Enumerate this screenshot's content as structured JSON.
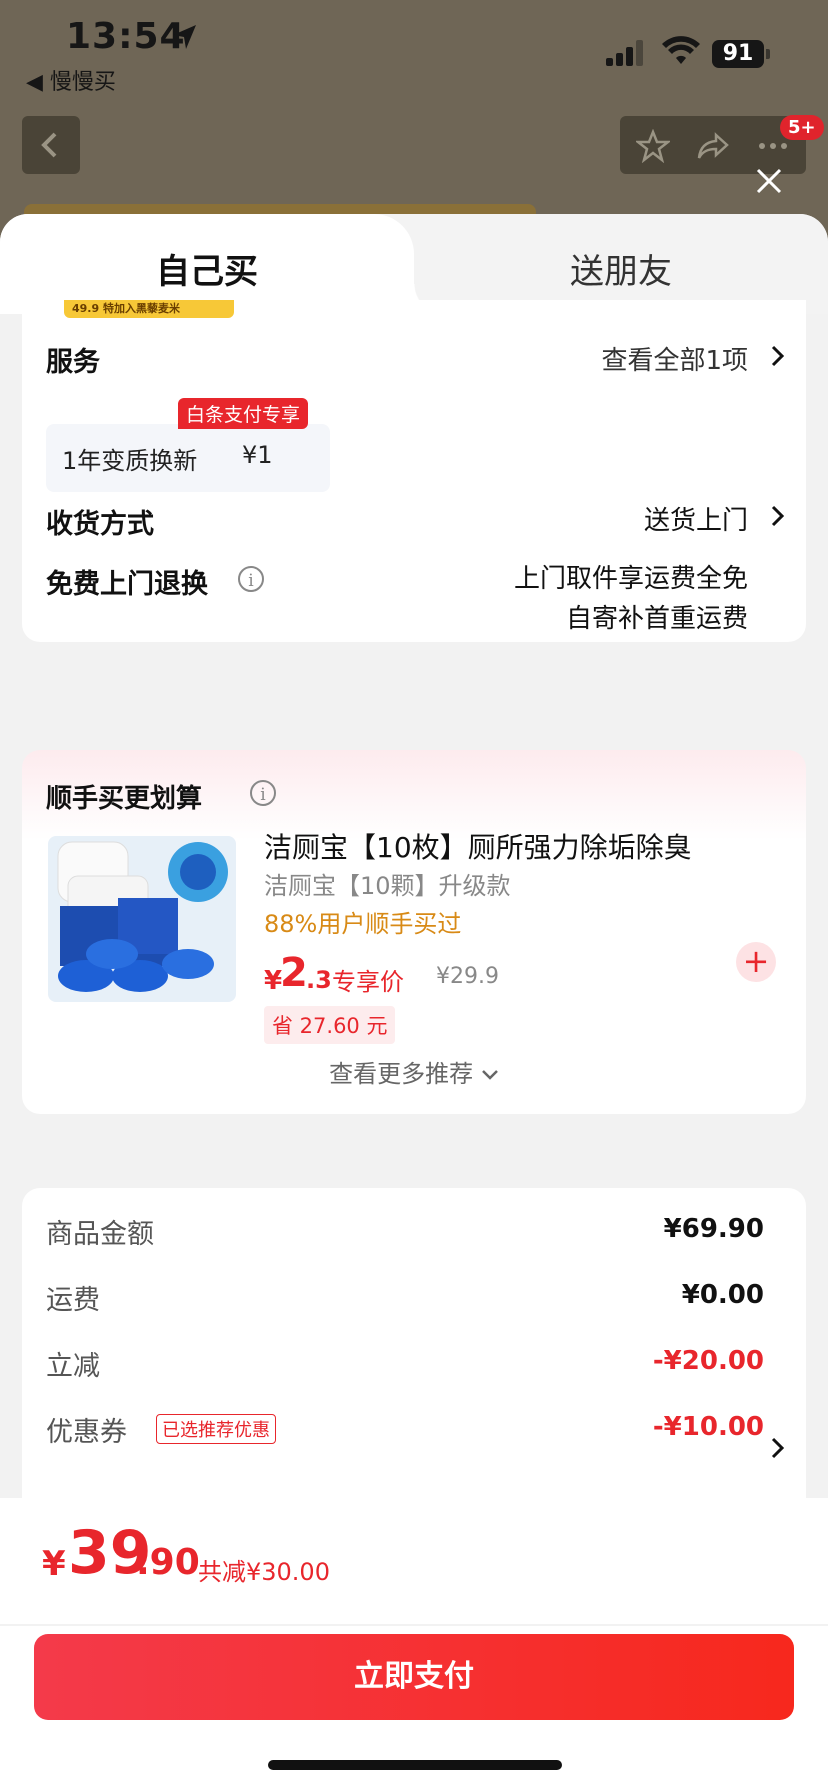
{
  "status_bar": {
    "time": "13:54",
    "back_app": "◀ 慢慢买",
    "battery": "91"
  },
  "nav": {
    "badge": "5+"
  },
  "tabs": [
    {
      "label": "自己买",
      "active": true
    },
    {
      "label": "送朋友",
      "active": false
    }
  ],
  "promo_strip_text": "特加入黑藜麦米",
  "promo_strip_price": "49.9",
  "service": {
    "title": "服务",
    "view_all": "查看全部1项",
    "item_name": "1年变质换新",
    "item_price": "¥1",
    "item_tag": "白条支付专享"
  },
  "delivery": {
    "title": "收货方式",
    "value": "送货上门"
  },
  "free_return": {
    "title": "免费上门退换",
    "line1": "上门取件享运费全免",
    "line2": "自寄补首重运费"
  },
  "addon": {
    "title": "顺手买更划算",
    "product_title": "洁厕宝【10枚】厕所强力除垢除臭",
    "product_sub": "洁厕宝【10颗】升级款",
    "bought_text": "88%用户顺手买过",
    "price_yen": "¥",
    "price_int": "2",
    "price_dec": ".3",
    "price_label": "专享价",
    "original_price": "¥29.9",
    "save_text": "省 27.60 元",
    "plus": "+",
    "more": "查看更多推荐"
  },
  "summary": [
    {
      "label": "商品金额",
      "value": "¥69.90",
      "red": false
    },
    {
      "label": "运费",
      "value": "¥0.00",
      "red": false
    },
    {
      "label": "立减",
      "value": "-¥20.00",
      "red": true
    },
    {
      "label": "优惠券",
      "tag": "已选推荐优惠",
      "value": "-¥10.00",
      "red": true
    }
  ],
  "total": {
    "yen": "¥",
    "int": "39",
    "dec": ".90",
    "saved": "共减¥30.00"
  },
  "pay_button": "立即支付",
  "colors": {
    "accent": "#e8262c",
    "orange": "#d88a16",
    "pay_start": "#f43a4a",
    "pay_end": "#f7281d"
  }
}
